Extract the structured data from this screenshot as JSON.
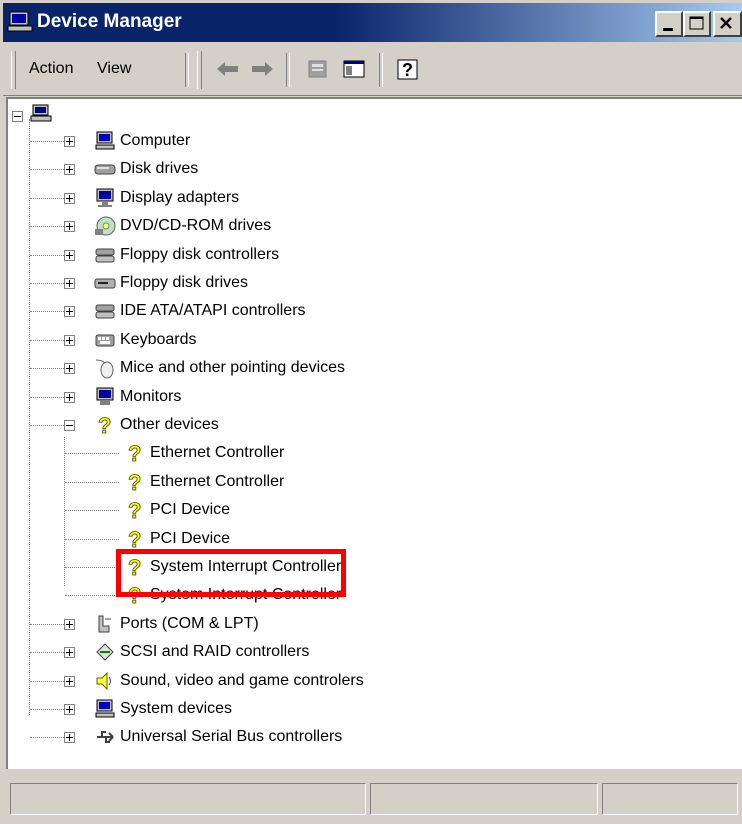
{
  "window": {
    "title": "Device Manager",
    "title_icon": "device-manager-icon"
  },
  "toolbar": {
    "menu": [
      "Action",
      "View"
    ],
    "tools": [
      "back-arrow-icon",
      "forward-arrow-icon",
      "properties-icon",
      "show-hide-console-tree-icon",
      "help-icon"
    ]
  },
  "tree": {
    "root_icon": "computer-root-icon",
    "categories": [
      {
        "label": "Computer",
        "icon": "computer-icon",
        "expanded": false
      },
      {
        "label": "Disk drives",
        "icon": "disk-drive-icon",
        "expanded": false
      },
      {
        "label": "Display adapters",
        "icon": "display-adapter-icon",
        "expanded": false
      },
      {
        "label": "DVD/CD-ROM drives",
        "icon": "cdrom-icon",
        "expanded": false
      },
      {
        "label": "Floppy disk controllers",
        "icon": "controller-icon",
        "expanded": false
      },
      {
        "label": "Floppy disk drives",
        "icon": "floppy-drive-icon",
        "expanded": false
      },
      {
        "label": "IDE ATA/ATAPI controllers",
        "icon": "controller-icon",
        "expanded": false
      },
      {
        "label": "Keyboards",
        "icon": "keyboard-icon",
        "expanded": false
      },
      {
        "label": "Mice and other pointing devices",
        "icon": "mouse-icon",
        "expanded": false
      },
      {
        "label": "Monitors",
        "icon": "monitor-icon",
        "expanded": false
      },
      {
        "label": "Other devices",
        "icon": "unknown-device-icon",
        "expanded": true
      },
      {
        "label": "Ports (COM & LPT)",
        "icon": "port-icon",
        "expanded": false
      },
      {
        "label": "SCSI and RAID controllers",
        "icon": "scsi-icon",
        "expanded": false
      },
      {
        "label": "Sound, video and game controlers",
        "icon": "speaker-icon",
        "expanded": false
      },
      {
        "label": "System devices",
        "icon": "computer-icon",
        "expanded": false
      },
      {
        "label": "Universal Serial Bus controllers",
        "icon": "usb-icon",
        "expanded": false
      }
    ],
    "other_devices": [
      {
        "label": "Ethernet Controller",
        "icon": "unknown-device-icon"
      },
      {
        "label": "Ethernet Controller",
        "icon": "unknown-device-icon",
        "highlighted": true
      },
      {
        "label": "PCI Device",
        "icon": "unknown-device-icon"
      },
      {
        "label": "PCI Device",
        "icon": "unknown-device-icon"
      },
      {
        "label": "System Interrupt Controller",
        "icon": "unknown-device-icon"
      },
      {
        "label": "System Interrupt Controller",
        "icon": "unknown-device-icon"
      }
    ]
  },
  "colors": {
    "title_bar_start": "#0a246a",
    "title_bar_end": "#a6caf0",
    "chrome": "#d4d0c8",
    "highlight_box": "#ff0000",
    "warning_yellow": "#ffff00"
  }
}
